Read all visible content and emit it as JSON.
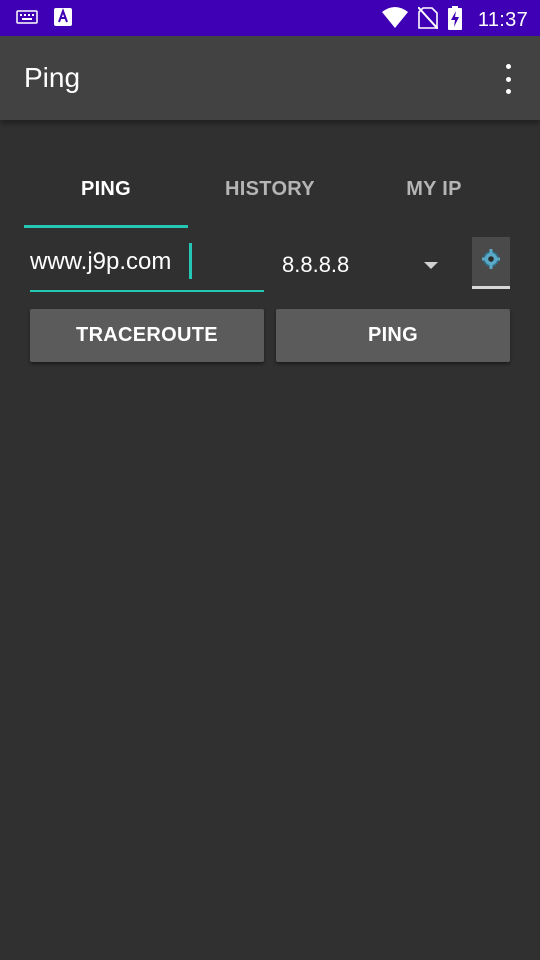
{
  "status_bar": {
    "time": "11:37",
    "icons": [
      "keyboard-icon",
      "a-notification-icon",
      "wifi-icon",
      "no-sim-icon",
      "battery-charging-icon"
    ]
  },
  "app_bar": {
    "title": "Ping",
    "overflow_icon": "more-vert-icon"
  },
  "tabs": [
    {
      "label": "PING",
      "active": true
    },
    {
      "label": "HISTORY",
      "active": false
    },
    {
      "label": "MY IP",
      "active": false
    }
  ],
  "host_input": {
    "value": "www.j9p.com"
  },
  "dns_select": {
    "selected": "8.8.8.8"
  },
  "actions": {
    "traceroute_label": "TRACEROUTE",
    "ping_label": "PING"
  },
  "colors": {
    "status_bar": "#3f00b5",
    "app_bar": "#424242",
    "background": "#303030",
    "accent": "#26c6b4",
    "button": "#5b5b5b"
  }
}
